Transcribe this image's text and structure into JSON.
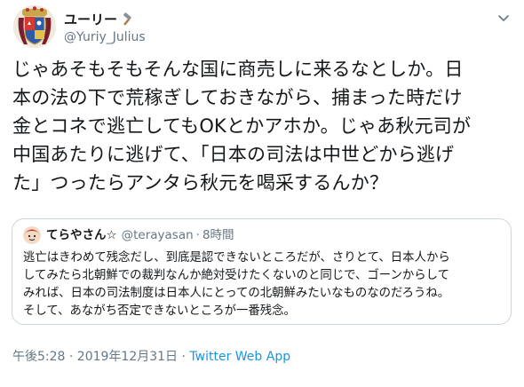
{
  "author": {
    "display_name": "ユーリー",
    "handle": "@Yuriy_Julius",
    "avatar_icon": "coat-of-arms-avatar",
    "name_emoji_icon": "hammer-icon"
  },
  "tweet": {
    "text": "じゃあそもそもそんな国に商売しに来るなとしか。日\n本の法の下で荒稼ぎしておきながら、捕まった時だけ\n金とコネで逃亡してもOKとかアホか。じゃあ秋元司が\n中国あたりに逃げて、「日本の司法は中世どから逃げ\nた」つったらアンタら秋元を喝采するんか？"
  },
  "quoted_tweet": {
    "author_name": "てらやさん☆",
    "handle": "@terayasan",
    "separator": "·",
    "time": "8時間",
    "avatar_icon": "cartoon-face-avatar",
    "text": "逃亡はきわめて残念だし、到底是認できないところだが、さりとて、日本人から\nしてみたら北朝鮮での裁判なんか絶対受けたくないのと同じで、ゴーンからして\nみれば、日本の司法制度は日本人にとっての北朝鮮みたいなものなのだろうね。\nそして、あながち否定できないところが一番残念。"
  },
  "meta": {
    "timestamp": "午後5:28 · 2019年12月31日 · ",
    "source_app": "Twitter Web App"
  },
  "colors": {
    "text": "#14171a",
    "secondary": "#657786",
    "link": "#1b95e0",
    "border": "#ccd6dd"
  }
}
